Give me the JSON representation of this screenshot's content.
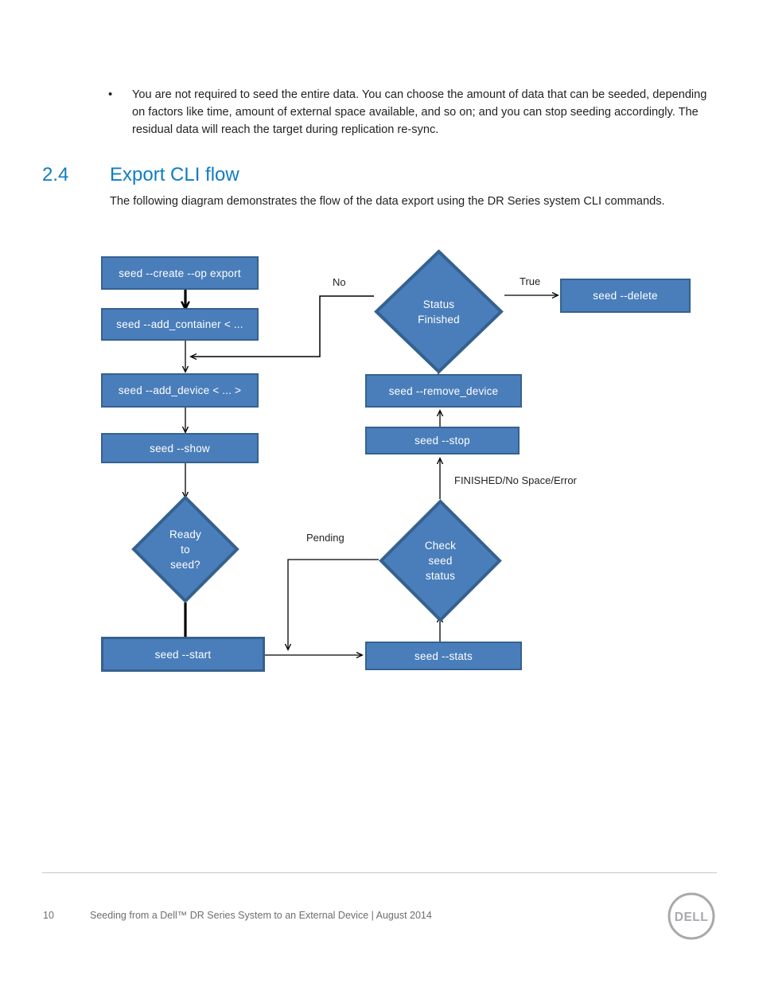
{
  "bullets": [
    {
      "marker": "•",
      "text": "You are not required to seed the entire data. You can choose the amount of data that can be seeded, depending on factors like time, amount of external space available, and so on; and you can stop seeding accordingly. The residual data will reach the target during replication re-sync."
    }
  ],
  "heading": {
    "number": "2.4",
    "title": "Export CLI flow",
    "color": "#0f7dc2"
  },
  "intro": "The following diagram demonstrates the flow of the data export using the DR Series system CLI commands.",
  "diagram": {
    "fill_color": "#4a7ebb",
    "stroke_color": "#35618f",
    "text_color": "#ffffff",
    "nodes": [
      {
        "id": "create",
        "shape": "box",
        "label": "seed --create --op export"
      },
      {
        "id": "add_container",
        "shape": "box",
        "label": "seed --add_container < ..."
      },
      {
        "id": "add_device",
        "shape": "box",
        "label": "seed --add_device < ... >"
      },
      {
        "id": "show",
        "shape": "box",
        "label": "seed --show"
      },
      {
        "id": "ready",
        "shape": "diamond",
        "label": "Ready\nto\nseed?"
      },
      {
        "id": "start",
        "shape": "box",
        "label": "seed --start"
      },
      {
        "id": "stats",
        "shape": "box",
        "label": "seed --stats"
      },
      {
        "id": "check_status",
        "shape": "diamond",
        "label": "Check\nseed\nstatus"
      },
      {
        "id": "stop",
        "shape": "box",
        "label": "seed --stop"
      },
      {
        "id": "remove_device",
        "shape": "box",
        "label": "seed --remove_device"
      },
      {
        "id": "status_finished",
        "shape": "diamond",
        "label": "Status\nFinished"
      },
      {
        "id": "delete",
        "shape": "box",
        "label": "seed --delete"
      }
    ],
    "edge_labels": [
      {
        "id": "no",
        "text": "No"
      },
      {
        "id": "true",
        "text": "True"
      },
      {
        "id": "pending",
        "text": "Pending"
      },
      {
        "id": "finished",
        "text": "FINISHED/No Space/Error"
      }
    ]
  },
  "footer": {
    "page_number": "10",
    "text": "Seeding from a Dell™ DR Series System to an External Device | August 2014",
    "logo_text": "DELL",
    "logo_color": "#a7a9ac"
  }
}
